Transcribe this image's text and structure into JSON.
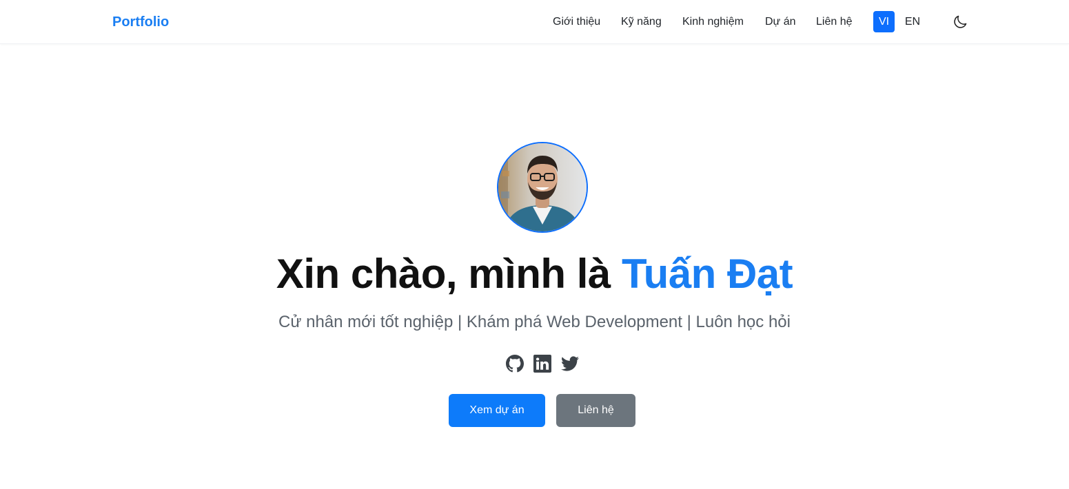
{
  "header": {
    "brand": "Portfolio",
    "nav": [
      {
        "label": "Giới thiệu"
      },
      {
        "label": "Kỹ năng"
      },
      {
        "label": "Kinh nghiệm"
      },
      {
        "label": "Dự án"
      },
      {
        "label": "Liên hệ"
      }
    ],
    "lang_active": "VI",
    "lang_other": "EN",
    "theme_icon": "moon-icon"
  },
  "hero": {
    "title_prefix": "Xin chào, mình là ",
    "name": "Tuấn Đạt",
    "subtitle": "Cử nhân mới tốt nghiệp | Khám phá Web Development | Luôn học hỏi",
    "socials": [
      "github-icon",
      "linkedin-icon",
      "twitter-icon"
    ],
    "primary_button": "Xem dự án",
    "secondary_button": "Liên hệ"
  },
  "colors": {
    "accent": "#0d6efd",
    "brand_text": "#1a7ef2",
    "secondary_button": "#6c757d",
    "subtitle_text": "#5a626b"
  }
}
